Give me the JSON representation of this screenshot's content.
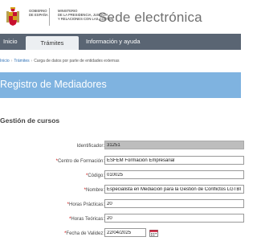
{
  "header": {
    "logo_gov_lines": [
      "GOBIERNO",
      "DE ESPAÑA"
    ],
    "logo_ministry_lines": [
      "MINISTERIO",
      "DE LA PRESIDENCIA, JUSTICIA",
      "Y RELACIONES CON LAS CORTES"
    ],
    "site_title": "Sede electrónica"
  },
  "nav": {
    "items": [
      {
        "label": "Inicio"
      },
      {
        "label": "Trámites"
      },
      {
        "label": "Información y ayuda"
      }
    ]
  },
  "breadcrumb": {
    "items": [
      "Inicio",
      "Trámites",
      "Carga de datos por parte de entidades externas"
    ],
    "separator": "›"
  },
  "banner": {
    "title": "Registro de Mediadores"
  },
  "section": {
    "title": "Gestión de cursos"
  },
  "form": {
    "fields": [
      {
        "label": "Identificador:",
        "required": false,
        "value": "31251"
      },
      {
        "label": "Centro de Formación:",
        "required": true,
        "value": "ESFEM Formación Empresarial"
      },
      {
        "label": "Código:",
        "required": true,
        "value": "010025"
      },
      {
        "label": "Nombre:",
        "required": true,
        "value": "Especialista en Mediación para la Gestión de Conflictos LGTBI"
      },
      {
        "label": "Horas Prácticas:",
        "required": true,
        "value": "20"
      },
      {
        "label": "Horas Teóricas:",
        "required": true,
        "value": "20"
      },
      {
        "label": "Fecha de Validez:",
        "required": true,
        "value": "22/04/2025"
      }
    ],
    "required_marker": "*"
  },
  "colors": {
    "nav_bg": "#5a6573",
    "banner_bg": "#7fb3e0",
    "link": "#2c6fb5",
    "required": "#cc0000",
    "readonly_input": "#bdbdbd"
  },
  "icons": {
    "crest": "spain-coat-of-arms-icon",
    "calendar": "calendar-icon"
  }
}
